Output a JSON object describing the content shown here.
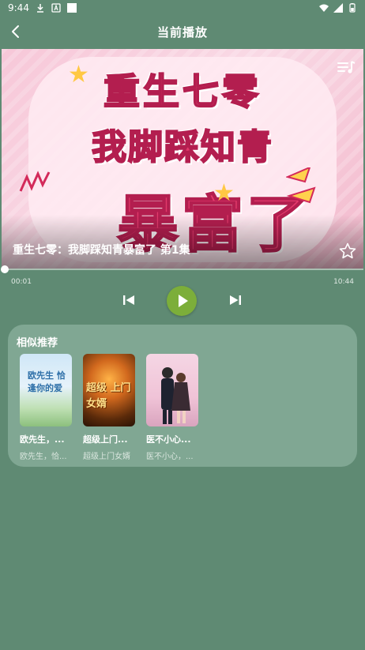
{
  "status_bar": {
    "time": "9:44",
    "icons_left": [
      "download-icon",
      "a-icon",
      "square-icon"
    ],
    "icons_right": [
      "wifi-icon",
      "signal-icon",
      "battery-icon"
    ]
  },
  "header": {
    "title": "当前播放",
    "back_icon": "chevron-left-icon"
  },
  "player": {
    "cover_text": [
      "重生七零",
      "我脚踩知青",
      "暴富了"
    ],
    "episode_title": "重生七零：我脚踩知青暴富了 第1集",
    "time_current": "00:01",
    "time_total": "10:44",
    "progress_fraction": 0.0016,
    "icons": [
      "playlist-icon",
      "star-icon",
      "skip-previous-icon",
      "play-icon",
      "skip-next-icon"
    ],
    "accent_color": "#7cae3a"
  },
  "recommendations": {
    "title": "相似推荐",
    "items": [
      {
        "name": "欧先生，...",
        "subtitle": "欧先生，恰...",
        "cover_text": "欧先生 恰逢你的爱"
      },
      {
        "name": "超级上门...",
        "subtitle": "超级上门女婿",
        "cover_text": "超级 上门女婿"
      },
      {
        "name": "医不小心...",
        "subtitle": "医不小心，...",
        "cover_text": ""
      }
    ]
  },
  "colors": {
    "background": "#5f8a73",
    "card": "#80a793"
  }
}
